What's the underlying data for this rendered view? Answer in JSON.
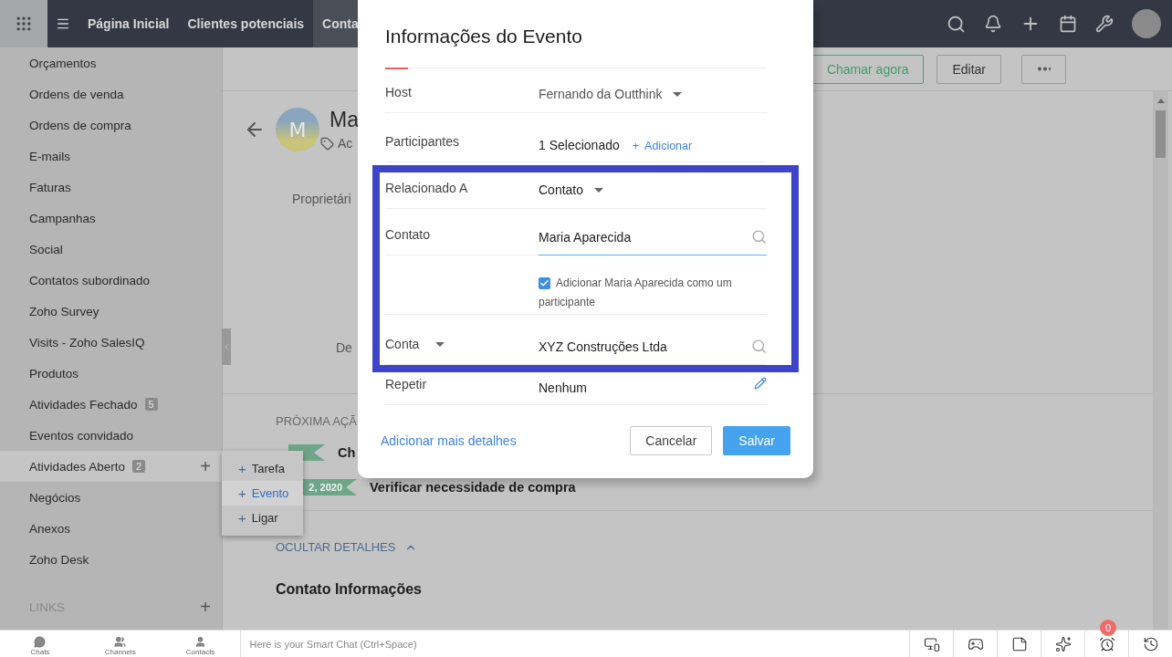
{
  "top_bar": {
    "tabs": [
      {
        "label": "Página Inicial",
        "selected": false
      },
      {
        "label": "Clientes potenciais",
        "selected": false
      },
      {
        "label": "Conta",
        "selected": true
      }
    ]
  },
  "sidebar": {
    "items": [
      {
        "label": "Orçamentos",
        "selected": false
      },
      {
        "label": "Ordens de venda",
        "selected": false
      },
      {
        "label": "Ordens de compra",
        "selected": false
      },
      {
        "label": "E-mails",
        "selected": false
      },
      {
        "label": "Faturas",
        "selected": false
      },
      {
        "label": "Campanhas",
        "selected": false
      },
      {
        "label": "Social",
        "selected": false
      },
      {
        "label": "Contatos subordinado",
        "selected": false
      },
      {
        "label": "Zoho Survey",
        "selected": false
      },
      {
        "label": "Visits - Zoho SalesIQ",
        "selected": false
      },
      {
        "label": "Produtos",
        "selected": false
      },
      {
        "label": "Atividades Fechado",
        "badge": "5",
        "selected": false
      },
      {
        "label": "Eventos convidado",
        "selected": false
      },
      {
        "label": "Atividades Aberto",
        "badge": "2",
        "action": "+",
        "selected": true
      },
      {
        "label": "Negócios",
        "selected": false
      },
      {
        "label": "Anexos",
        "selected": false
      },
      {
        "label": "Zoho Desk",
        "selected": false
      }
    ],
    "section": {
      "title": "LINKS",
      "action": "+"
    }
  },
  "action_menu": {
    "items": [
      {
        "icon": "+",
        "label": "Tarefa",
        "selected": false
      },
      {
        "icon": "+",
        "label": "Evento",
        "selected": true
      },
      {
        "icon": "+",
        "label": "Ligar",
        "selected": false
      }
    ]
  },
  "record": {
    "toolbar": [
      {
        "kind": "call",
        "label": "Chamar agora"
      },
      {
        "kind": "plain",
        "label": "Editar"
      },
      {
        "kind": "more"
      }
    ],
    "avatar_initial": "M",
    "title": "Ma",
    "tag": "Ac",
    "owner_label": "Proprietári",
    "field_label": "De",
    "next_actions": {
      "title": "PRÓXIMA AÇÃ",
      "items": [
        {
          "title": "Ch"
        },
        {
          "date": "2, 2020",
          "title": "Verificar necessidade de compra"
        }
      ]
    },
    "toggle": "OCULTAR DETALHES",
    "section_title": "Contato Informações"
  },
  "dialog": {
    "title": "Informações do Evento",
    "fields": [
      {
        "kind": "select",
        "label": "Host",
        "value": "Fernando da Outthink",
        "highlighted": false
      },
      {
        "kind": "participants",
        "label": "Participantes",
        "value": "1 Selecionado",
        "action_icon": "+",
        "action": "Adicionar",
        "highlighted": false
      },
      {
        "kind": "select",
        "label": "Relacionado A",
        "value": "Contato",
        "highlighted": true
      },
      {
        "kind": "lookup",
        "label": "Contato",
        "value": "Maria Aparecida",
        "focused": true,
        "highlighted": true
      },
      {
        "kind": "checkbox",
        "text": "Adicionar Maria Aparecida como um participante",
        "checked": true,
        "highlighted": true
      },
      {
        "kind": "lookup",
        "label": "Conta",
        "label_menu": true,
        "value": "XYZ Construções Ltda",
        "focused": false,
        "highlighted": true
      },
      {
        "kind": "text",
        "label": "Repetir",
        "value": "Nenhum",
        "editable": true,
        "highlighted": false
      }
    ],
    "more_link": "Adicionar mais detalhes",
    "buttons": [
      {
        "kind": "secondary",
        "label": "Cancelar"
      },
      {
        "kind": "primary",
        "label": "Salvar"
      }
    ]
  },
  "bottom_bar": {
    "tabs": [
      {
        "label": "Chats"
      },
      {
        "label": "Channels"
      },
      {
        "label": "Contacts"
      }
    ],
    "chat": {
      "placeholder": "Here is your Smart Chat (Ctrl+Space)"
    },
    "reminder_badge": "0"
  }
}
